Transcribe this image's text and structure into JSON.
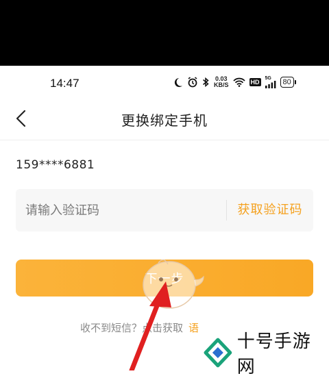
{
  "status_bar": {
    "time": "14:47",
    "net_speed_value": "0.03",
    "net_speed_unit": "KB/S",
    "hd_label": "HD",
    "signal_label": "5G",
    "battery": "80"
  },
  "nav": {
    "title": "更换绑定手机"
  },
  "form": {
    "phone_number": "159****6881",
    "code_placeholder": "请输入验证码",
    "get_code_label": "获取验证码",
    "next_label": "下一步"
  },
  "hint": {
    "text": "收不到短信？点击获取",
    "voice_link": "语"
  },
  "watermark": {
    "text": "十号手游网"
  },
  "colors": {
    "accent": "#f5a11e",
    "button": "#f9a826",
    "arrow": "#e02020"
  }
}
